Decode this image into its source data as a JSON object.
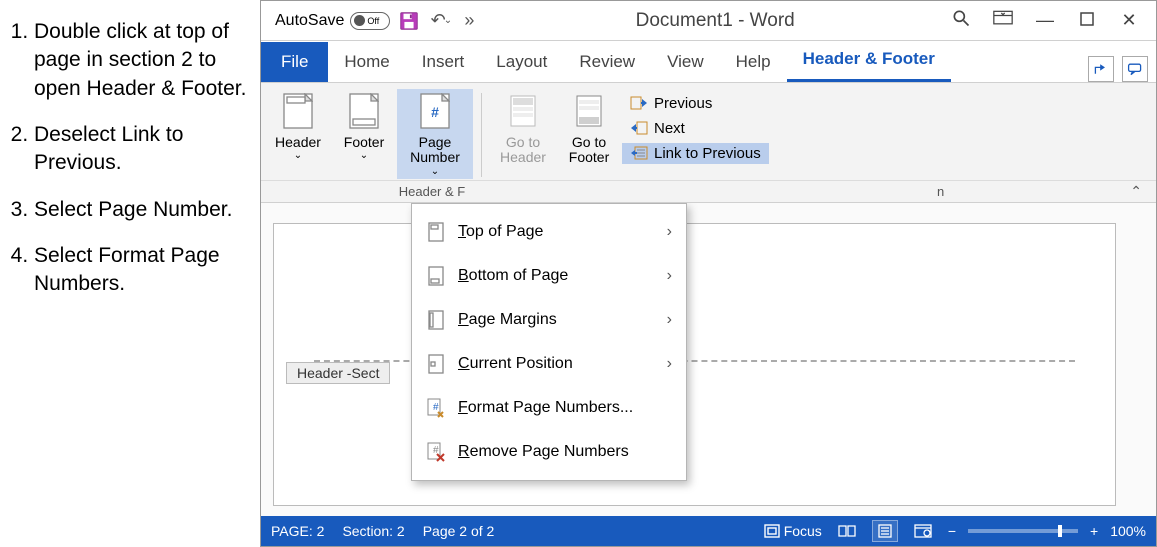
{
  "instructions": {
    "i1": "Double click at top of page in section 2 to open Header & Footer.",
    "i2": "Deselect Link to Previous.",
    "i3": "Select Page Number.",
    "i4": "Select Format Page Numbers."
  },
  "titlebar": {
    "autosave_label": "AutoSave",
    "autosave_state": "Off",
    "doc_title": "Document1 - Word"
  },
  "tabs": {
    "file": "File",
    "home": "Home",
    "insert": "Insert",
    "layout": "Layout",
    "review": "Review",
    "view": "View",
    "help": "Help",
    "hf": "Header & Footer"
  },
  "ribbon": {
    "header": "Header",
    "footer": "Footer",
    "page_number": "Page Number",
    "goto_header": "Go to Header",
    "goto_footer": "Go to Footer",
    "previous": "Previous",
    "next": "Next",
    "link_prev": "Link to Previous",
    "group_hf": "Header & F",
    "group_nav_partial": "n"
  },
  "menu": {
    "top": "Top of Page",
    "bottom": "Bottom of Page",
    "margins": "Page Margins",
    "current": "Current Position",
    "format": "Format Page Numbers...",
    "remove": "Remove Page Numbers"
  },
  "canvas": {
    "header_label": "Header -Sect"
  },
  "status": {
    "page": "PAGE: 2",
    "section": "Section: 2",
    "pages": "Page 2 of 2",
    "focus": "Focus",
    "zoom": "100%"
  },
  "colors": {
    "accent": "#185abd",
    "ribbon_bg": "#f3f3f3",
    "highlight": "#c7d7ef",
    "selected": "#b9cdec"
  }
}
